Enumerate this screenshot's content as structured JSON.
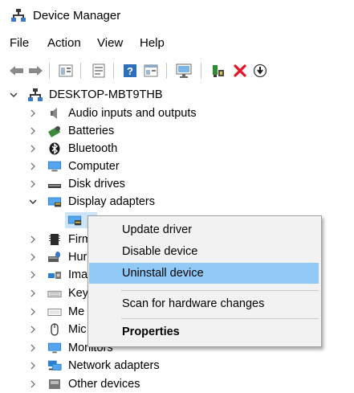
{
  "window": {
    "title": "Device Manager",
    "title_icon": "device-manager-icon"
  },
  "menubar": {
    "items": [
      "File",
      "Action",
      "View",
      "Help"
    ]
  },
  "toolbar": {
    "buttons": [
      "back-arrow-icon",
      "forward-arrow-icon",
      "properties-icon",
      "update-icon",
      "help-icon",
      "show-hidden-icon",
      "monitor-icon",
      "add-driver-icon",
      "uninstall-x-icon",
      "download-circle-icon"
    ]
  },
  "tree": {
    "root": "DESKTOP-MBT9THB",
    "items": [
      {
        "label": "Audio inputs and outputs",
        "icon": "speaker-icon"
      },
      {
        "label": "Batteries",
        "icon": "battery-icon"
      },
      {
        "label": "Bluetooth",
        "icon": "bluetooth-icon"
      },
      {
        "label": "Computer",
        "icon": "computer-icon"
      },
      {
        "label": "Disk drives",
        "icon": "disk-drive-icon"
      },
      {
        "label": "Display adapters",
        "icon": "display-adapter-icon"
      },
      {
        "label": "Firm",
        "icon": "firmware-icon"
      },
      {
        "label": "Hur",
        "icon": "hid-icon"
      },
      {
        "label": "Ima",
        "icon": "imaging-icon"
      },
      {
        "label": "Key",
        "icon": "keyboard-icon"
      },
      {
        "label": "Me",
        "icon": "memory-icon"
      },
      {
        "label": "Mic",
        "icon": "mouse-icon"
      },
      {
        "label": "Monitors",
        "icon": "monitor-icon"
      },
      {
        "label": "Network adapters",
        "icon": "network-adapter-icon"
      },
      {
        "label": "Other devices",
        "icon": "other-device-icon"
      }
    ]
  },
  "context_menu": {
    "items": [
      "Update driver",
      "Disable device",
      "Uninstall device",
      "Scan for hardware changes",
      "Properties"
    ],
    "highlighted": "Uninstall device"
  },
  "colors": {
    "highlight": "#91c9f7",
    "menu_bg": "#f2f2f2",
    "uninstall_red": "#e81123"
  }
}
